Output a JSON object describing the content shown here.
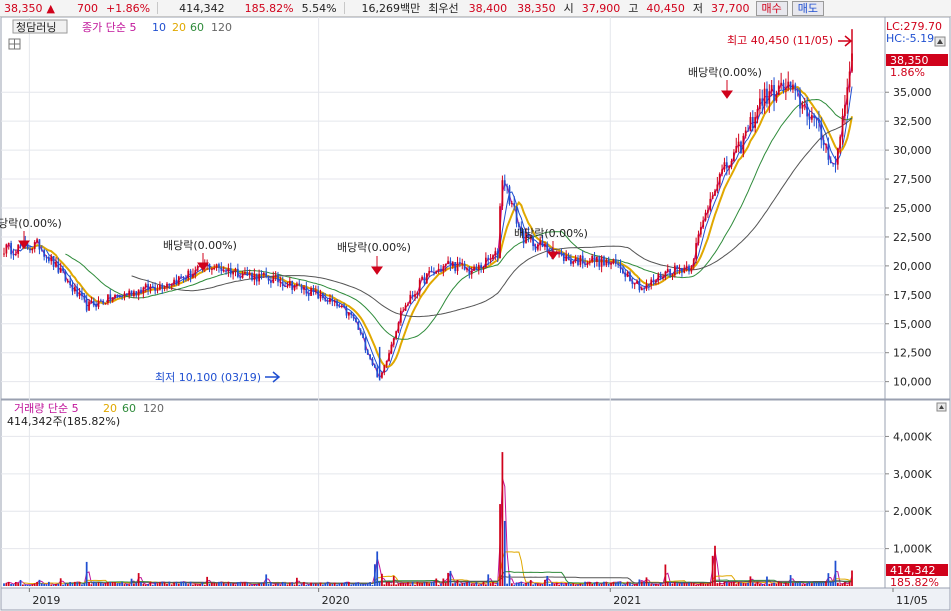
{
  "top_bar": {
    "price": "38,350",
    "change_arrow": "▲",
    "change": "700",
    "change_pct": "+1.86%",
    "volume": "414,342",
    "volume_ratio": "185.82%",
    "turnover": "5.54%",
    "trade_value": "16,269백만",
    "best_ask_label": "최우선",
    "best_ask": "38,400",
    "best_bid": "38,350",
    "open_label": "시",
    "open": "37,900",
    "high_label": "고",
    "high": "40,450",
    "low_label": "저",
    "low": "37,700",
    "buy_button": "매수",
    "sell_button": "매도"
  },
  "colors": {
    "up": "#d0021b",
    "down": "#1f4fd1",
    "ma5": "#c0149a",
    "ma10": "#1f4fd1",
    "ma20": "#e0a800",
    "ma60": "#2e8b3a",
    "ma120": "#555555"
  },
  "price_panel": {
    "stock_name": "청담러닝",
    "legend_prefix": "종가 단순 5",
    "legend_ma10": "10",
    "legend_ma20": "20",
    "legend_ma60": "60",
    "legend_ma120": "120",
    "lc": "LC:279.70",
    "hc": "HC:-5.19",
    "last_price_tag": "38,350",
    "last_pct_tag": "1.86%",
    "high_note": "최고 40,450 (11/05)",
    "low_note": "최저 10,100 (03/19)",
    "dividend_notes": [
      "당락(0.00%)",
      "배당락(0.00%)",
      "배당락(0.00%)",
      "배당락(0.00%)",
      "배당락(0.00%)"
    ]
  },
  "volume_panel": {
    "legend_prefix": "거래량 단순 5",
    "legend_ma20": "20",
    "legend_ma60": "60",
    "legend_ma120": "120",
    "value_note": "414,342주(185.82%)",
    "last_volume_tag": "414,342",
    "last_volume_pct_tag": "185.82%"
  },
  "x_axis": {
    "labels": [
      "2019",
      "2020",
      "2021",
      "11/05"
    ]
  },
  "chart_data": [
    {
      "type": "line",
      "title": "청담러닝",
      "y_axis_ticks": [
        10000,
        12500,
        15000,
        17500,
        20000,
        22500,
        25000,
        27500,
        30000,
        32500,
        35000
      ],
      "y_axis_tick_labels": [
        "10,000",
        "12,500",
        "15,000",
        "17,500",
        "20,000",
        "22,500",
        "25,000",
        "27,500",
        "30,000",
        "32,500",
        "35,000"
      ],
      "ylim": [
        8500,
        41500
      ],
      "x_period": [
        "2018-12",
        "2021-11-05"
      ],
      "close_series_approx": {
        "x": [
          "2018-12",
          "2019-01",
          "2019-02",
          "2019-03",
          "2019-04",
          "2019-05",
          "2019-06",
          "2019-07",
          "2019-08",
          "2019-09",
          "2019-10",
          "2019-11",
          "2019-12",
          "2020-01",
          "2020-02",
          "2020-03-19",
          "2020-04",
          "2020-05",
          "2020-06",
          "2020-07",
          "2020-08",
          "2020-08-20",
          "2020-09",
          "2020-10",
          "2020-11",
          "2020-12",
          "2021-01",
          "2021-02",
          "2021-03",
          "2021-04",
          "2021-05",
          "2021-06",
          "2021-07",
          "2021-08",
          "2021-09",
          "2021-10",
          "2021-11-05"
        ],
        "values": [
          21500,
          21800,
          19000,
          16500,
          17200,
          17800,
          18300,
          19000,
          20000,
          19600,
          19100,
          18700,
          18000,
          17000,
          15500,
          10100,
          16000,
          19000,
          20200,
          19500,
          21000,
          28000,
          22500,
          21500,
          20500,
          20500,
          20000,
          18000,
          19500,
          20000,
          27000,
          30000,
          34500,
          35500,
          33000,
          28500,
          38350
        ]
      },
      "extremes": {
        "high": 40450,
        "high_date": "11/05",
        "low": 10100,
        "low_date": "03/19"
      },
      "last_close": 38350
    },
    {
      "type": "bar",
      "title": "거래량",
      "y_axis_ticks": [
        1000000,
        2000000,
        3000000,
        4000000
      ],
      "y_axis_tick_labels": [
        "1,000K",
        "2,000K",
        "3,000K",
        "4,000K"
      ],
      "ylim": [
        0,
        4600000
      ],
      "spikes_approx": {
        "x": [
          "2019-03",
          "2020-03",
          "2020-06",
          "2020-08-20",
          "2020-08-24",
          "2021-03",
          "2021-05",
          "2021-10",
          "2021-11-05"
        ],
        "values": [
          700000,
          1200000,
          600000,
          4600000,
          1800000,
          650000,
          1500000,
          700000,
          414342
        ]
      },
      "last_volume": 414342
    }
  ]
}
